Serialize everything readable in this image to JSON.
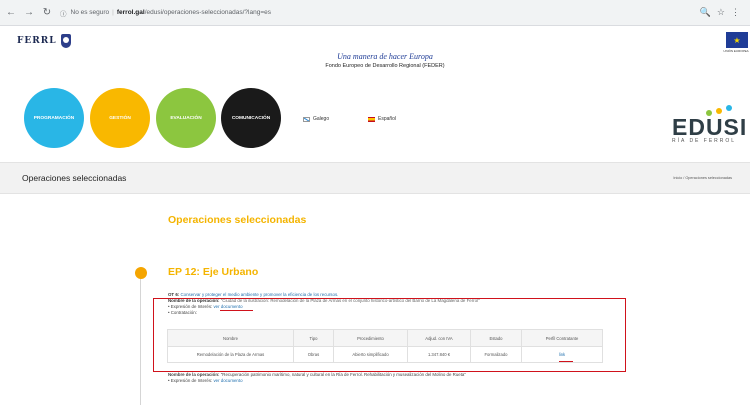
{
  "browser": {
    "security": "No es seguro",
    "host": "ferrol.gal",
    "path": "/edusi/operaciones-seleccionadas/?lang=es"
  },
  "header": {
    "logo_text": "FERRL",
    "motto": "Una manera de hacer Europa",
    "fund": "Fondo Europeo de Desarrollo Regional (FEDER)",
    "eu_caption": "UNIÓN EUROPEA"
  },
  "nav": [
    {
      "label": "Programación",
      "color": "#29b6e6"
    },
    {
      "label": "Gestión",
      "color": "#f9b800"
    },
    {
      "label": "Evaluación",
      "color": "#8cc63f"
    },
    {
      "label": "Comunicación",
      "color": "#1a1a1a"
    }
  ],
  "languages": [
    {
      "label": "Galego"
    },
    {
      "label": "Español"
    }
  ],
  "edusi": {
    "word": "EDUSI",
    "sub": "RÍA DE FERROL"
  },
  "page": {
    "title": "Operaciones seleccionadas",
    "breadcrumb": "Inicio  /  Operaciones seleccionadas",
    "section_title": "Operaciones seleccionadas"
  },
  "ep": {
    "title": "EP 12: Eje Urbano",
    "ot_label": "OT 6:",
    "ot_text": "Conservar y proteger el medio ambiente y promover la eficiencia de los recursos.",
    "op1_label": "Nombre de la operación:",
    "op1_text": "\"Ciudad de la ilustración: Remodelación de la Plaza de Armas en el conjunto histórico-artístico del Barrio de La Magdalena de Ferrol\"",
    "expr_label": "• Expresión de Interés:",
    "expr_link": "ver documento",
    "contract_label": "• Contratación:",
    "op2_label": "Nombre de la operación:",
    "op2_text": "\"Recuperación patrimonio marítimo, natural y cultural en la Ría de Ferrol. Rehabilitación y musealización del Molino de Rueta\"",
    "expr2_label": "• Expresión de Interés:",
    "expr2_link": "ver documento"
  },
  "table": {
    "headers": [
      "Nombre",
      "Tipo",
      "Procedimiento",
      "Adjud. con IVA",
      "Estado",
      "Perfil Contratante"
    ],
    "row": [
      "Remodelación de la Plaza de Armas",
      "Obras",
      "Abierto simplificado",
      "1.347.840 €",
      "Formalizado",
      "link"
    ]
  },
  "colors": {
    "accent": "#f4b400",
    "highlight": "#d0121b",
    "link": "#1f6fae"
  }
}
